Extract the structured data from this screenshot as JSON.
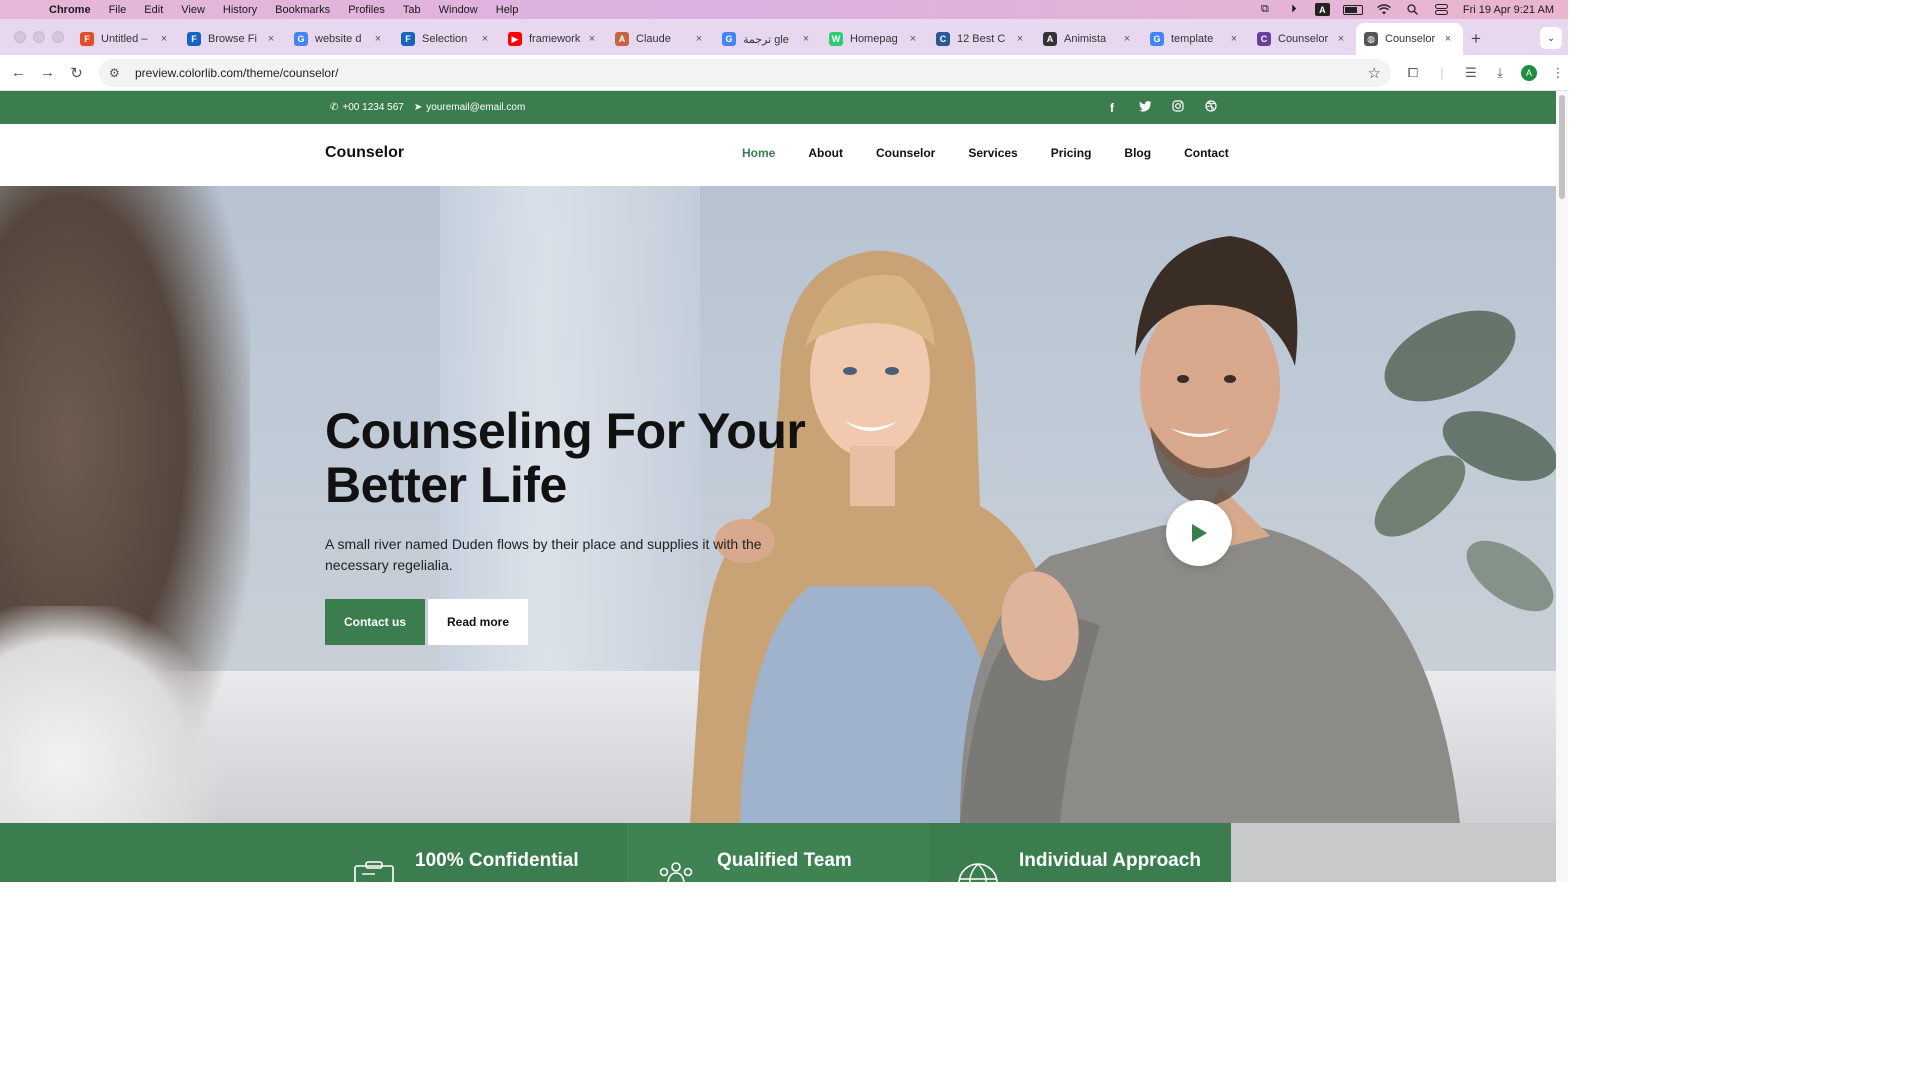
{
  "menubar": {
    "app": "Chrome",
    "items": [
      "File",
      "Edit",
      "View",
      "History",
      "Bookmarks",
      "Profiles",
      "Tab",
      "Window",
      "Help"
    ],
    "clock": "Fri 19 Apr  9:21 AM",
    "badge": "A"
  },
  "tabs": [
    {
      "label": "Untitled –",
      "color": "#e44d26",
      "glyph": "F"
    },
    {
      "label": "Browse Fi",
      "color": "#1565c0",
      "glyph": "F"
    },
    {
      "label": "website d",
      "color": "#4285f4",
      "glyph": "G"
    },
    {
      "label": "Selection",
      "color": "#1565c0",
      "glyph": "F"
    },
    {
      "label": "framework",
      "color": "#ff0000",
      "glyph": "▶"
    },
    {
      "label": "Claude",
      "color": "#c96442",
      "glyph": "A"
    },
    {
      "label": "ترجمة gle",
      "color": "#4285f4",
      "glyph": "G"
    },
    {
      "label": "Homepag",
      "color": "#2ecc71",
      "glyph": "W"
    },
    {
      "label": "12 Best C",
      "color": "#2b5797",
      "glyph": "C"
    },
    {
      "label": "Animista",
      "color": "#333333",
      "glyph": "A"
    },
    {
      "label": "template",
      "color": "#4285f4",
      "glyph": "G"
    },
    {
      "label": "Counselor",
      "color": "#6a3d9a",
      "glyph": "C"
    },
    {
      "label": "Counselor",
      "color": "#555555",
      "glyph": "◍"
    }
  ],
  "address": {
    "url": "preview.colorlib.com/theme/counselor/"
  },
  "topbar": {
    "phone": "+00 1234 567",
    "email": "youremail@email.com",
    "social": [
      "f",
      "t",
      "ig",
      "dr"
    ]
  },
  "nav": {
    "brand": "Counselor",
    "items": [
      "Home",
      "About",
      "Counselor",
      "Services",
      "Pricing",
      "Blog",
      "Contact"
    ],
    "active": "Home"
  },
  "hero": {
    "title_line1": "Counseling For Your",
    "title_line2": "Better Life",
    "subtitle": "A small river named Duden flows by their place and supplies it with the necessary regelialia.",
    "primary_button": "Contact us",
    "secondary_button": "Read more"
  },
  "features": [
    {
      "title": "100% Confidential",
      "icon": "clipboard-icon"
    },
    {
      "title": "Qualified Team",
      "icon": "team-icon"
    },
    {
      "title": "Individual Approach",
      "icon": "globe-icon"
    }
  ],
  "colors": {
    "brand_green": "#3b7d4f",
    "text_dark": "#111111"
  }
}
